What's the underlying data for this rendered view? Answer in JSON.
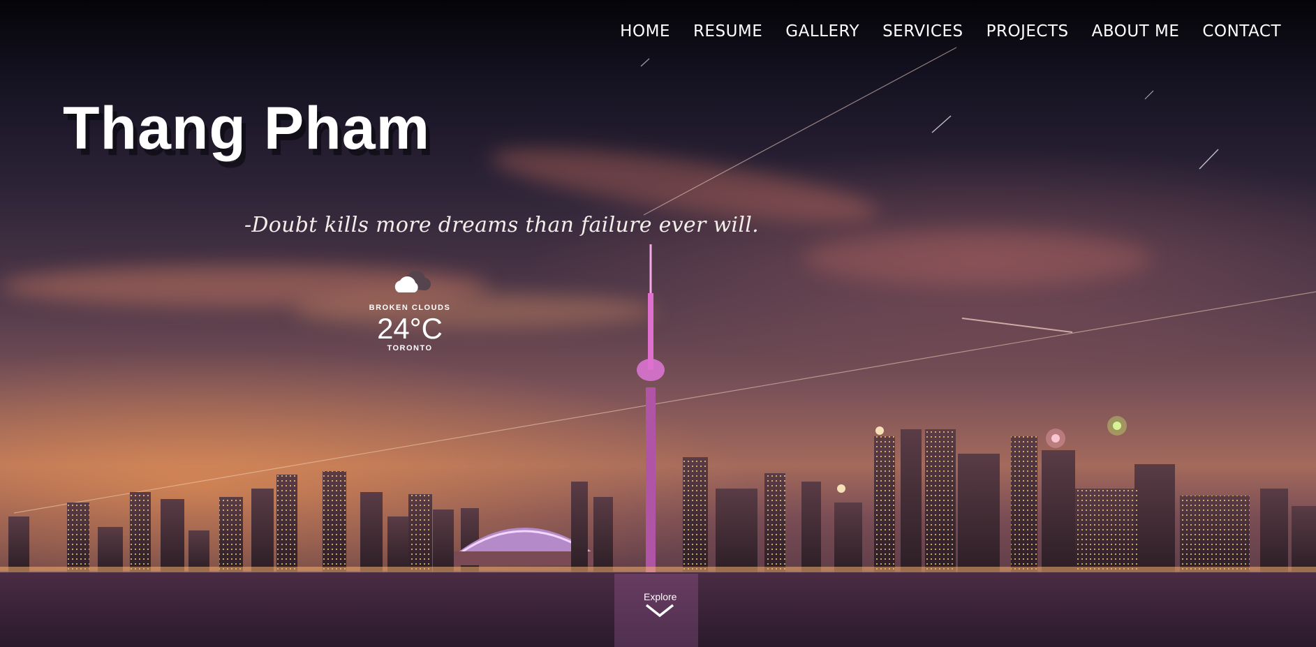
{
  "nav": {
    "items": [
      "HOME",
      "RESUME",
      "GALLERY",
      "SERVICES",
      "PROJECTS",
      "ABOUT ME",
      "CONTACT"
    ]
  },
  "hero": {
    "name": "Thang Pham",
    "quote": "-Doubt kills more dreams than failure ever will."
  },
  "weather": {
    "icon": "cloud-icon",
    "condition": "BROKEN CLOUDS",
    "temperature": "24°C",
    "city": "TORONTO"
  },
  "explore": {
    "label": "Explore",
    "icon": "chevron-down-icon"
  },
  "colors": {
    "tower_accent": "#e070d0",
    "city_lights": "#ffcf80"
  }
}
